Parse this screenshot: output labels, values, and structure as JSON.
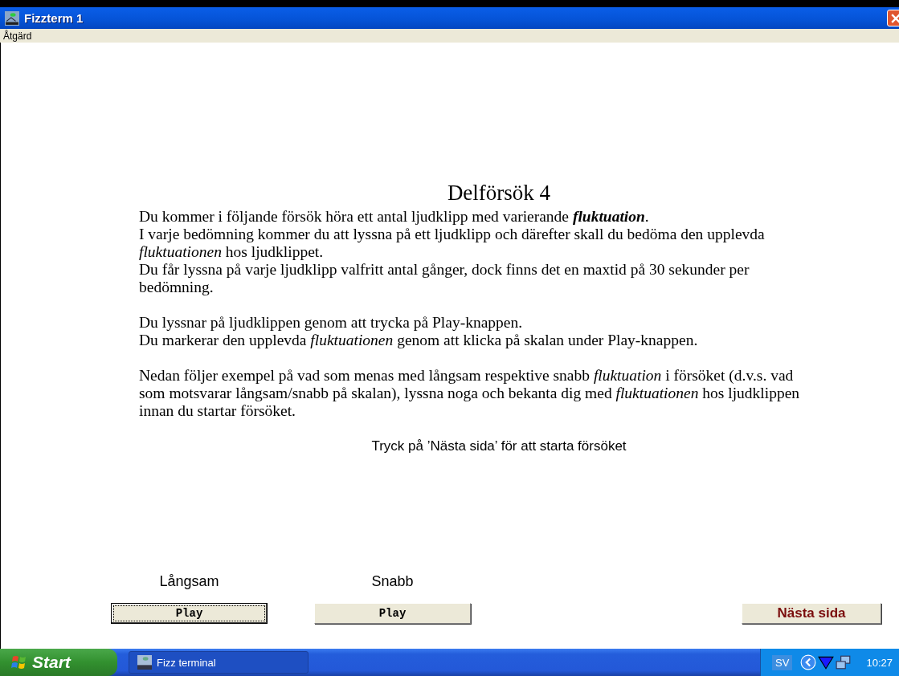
{
  "window": {
    "title": "Fizzterm 1"
  },
  "menu": [
    "Åtgärd"
  ],
  "heading": "Delförsök 4",
  "paragraphs": [
    [
      "Du kommer i följande försök höra ett antal ljudklipp med varierande **fluktuation**.",
      "I varje bedömning kommer du att lyssna på ett ljudklipp och därefter skall du bedöma den upplevda *fluktuationen* hos ljudklippet.",
      "Du får lyssna på varje ljudklipp valfritt antal gånger, dock finns det en maxtid på 30 sekunder per bedömning."
    ],
    [
      "Du lyssnar på ljudklippen genom att trycka på Play-knappen.",
      "Du markerar den upplevda *fluktuationen* genom att klicka på skalan under Play-knappen."
    ],
    [
      "Nedan följer exempel på vad som menas med långsam respektive snabb *fluktuation* i försöket (d.v.s. vad som motsvarar långsam/snabb på skalan), lyssna noga och bekanta dig med *fluktuationen* hos ljudklippen innan du startar försöket."
    ]
  ],
  "instruction": "Tryck på ’Nästa sida’ för att starta försöket",
  "examples": [
    {
      "label": "Långsam",
      "button": "Play",
      "focused": true
    },
    {
      "label": "Snabb",
      "button": "Play",
      "focused": false
    }
  ],
  "next_button": "Nästa sida",
  "taskbar": {
    "start": "Start",
    "tasks": [
      "Fizz terminal"
    ],
    "language": "SV",
    "time": "10:27"
  }
}
